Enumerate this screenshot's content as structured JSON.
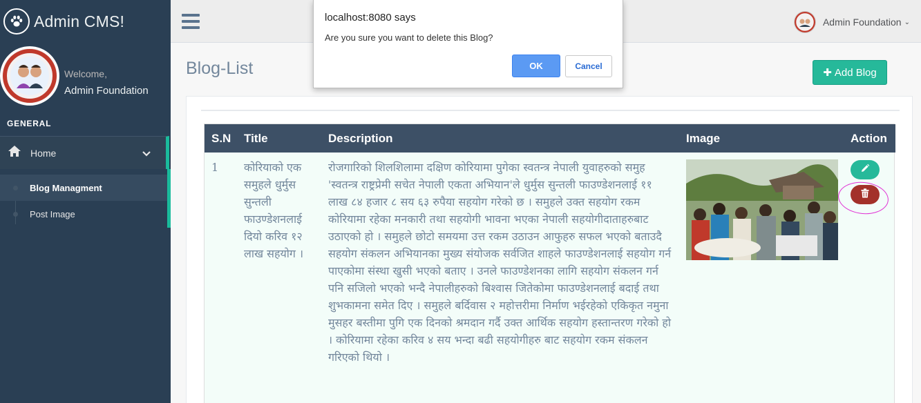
{
  "sidebar": {
    "brand_title": "Admin CMS!",
    "welcome": "Welcome,",
    "profile_name": "Admin Foundation",
    "section_label": "GENERAL",
    "home_label": "Home",
    "sub_items": [
      {
        "label": "Blog Managment",
        "active": true
      },
      {
        "label": "Post Image",
        "active": false
      }
    ]
  },
  "topnav": {
    "user_name": "Admin Foundation"
  },
  "page": {
    "title": "Blog-List",
    "add_button": "Add Blog"
  },
  "table": {
    "headers": [
      "S.N",
      "Title",
      "Description",
      "Image",
      "Action"
    ],
    "rows": [
      {
        "sn": "1",
        "title": "कोरियाको एक समुहले धुर्मुस सुन्तली फाउण्डेशनलाई दियो करिव १२ लाख सहयोग ।",
        "description": "रोजगारिको शिलशिलामा दक्षिण कोरियामा पुगेका स्वतन्त्र नेपाली युवाहरुको समुह 'स्वतन्त्र राष्ट्रप्रेमी सचेत नेपाली एकता अभियान'ले धुर्मुस सुन्तली फाउण्डेशनलाई ११ लाख ८४ हजार ८ सय ६३ रुपैया सहयोग गरेको छ । समुहले उक्त सहयोग रकम कोरियामा रहेका मनकारी तथा सहयोगी भावना भएका नेपाली सहयोगीदाताहरुबाट उठाएको हो । समुहले छोटो समयमा उत्त रकम उठाउन आफुहरु सफल भएको बताउदै सहयोग संकलन अभियानका मुख्य संयोजक सर्वजित शाहले फाउण्डेशनलाई सहयोग गर्न पाएकोमा संस्था खुसी भएको बताए । उनले फाउण्डेशनका लागि सहयोग संकलन गर्न पनि सजिलो भएको भन्दै नेपालीहरुको बिश्वास जितेकोमा फाउण्डेशनलाई बदाई तथा शुभकामना समेत दिए । समुहले बर्दिवास २ महोत्तरीमा निर्माण भईरहेको एकिकृत नमुना मुसहर बस्तीमा पुगि एक दिनको श्रमदान गर्दै उक्त आर्थिक सहयोग हस्तान्तरण गरेको हो । कोरियामा रहेका करिव ४ सय भन्दा बढी सहयोगीहरु बाट सहयोग रकम संकलन गरिएको थियो ।"
      }
    ]
  },
  "dialog": {
    "title": "localhost:8080 says",
    "message": "Are you sure you want to delete this Blog?",
    "ok_label": "OK",
    "cancel_label": "Cancel"
  },
  "colors": {
    "sidebar_bg": "#2a3f54",
    "accent": "#1abb9c",
    "table_header": "#3d5066",
    "edit_button": "#26b99a",
    "delete_button": "#a3312a",
    "ok_button": "#5b9af3",
    "annotation": "#e02fd4"
  },
  "icons": [
    "paw-icon",
    "home-icon",
    "chevron-down-icon",
    "menu-icon",
    "plus-icon",
    "pencil-icon",
    "trash-icon"
  ]
}
